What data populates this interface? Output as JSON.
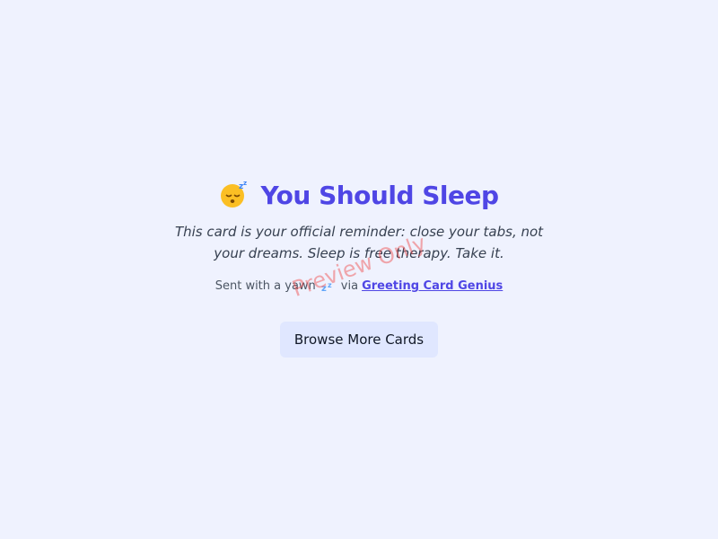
{
  "card": {
    "title": "You Should Sleep",
    "title_icon": "sleeping-face-emoji",
    "message": "This card is your official reminder: close your tabs, not your dreams. Sleep is free therapy. Take it.",
    "footer": {
      "prefix": "Sent with a yawn",
      "icon": "zzz-emoji",
      "via": "via",
      "link_text": "Greeting Card Genius"
    },
    "button_label": "Browse More Cards"
  },
  "watermark": "Preview Only",
  "colors": {
    "background": "#eff2fe",
    "accent": "#4f46e5",
    "button_bg": "#e0e7ff",
    "watermark": "#ef4444"
  }
}
